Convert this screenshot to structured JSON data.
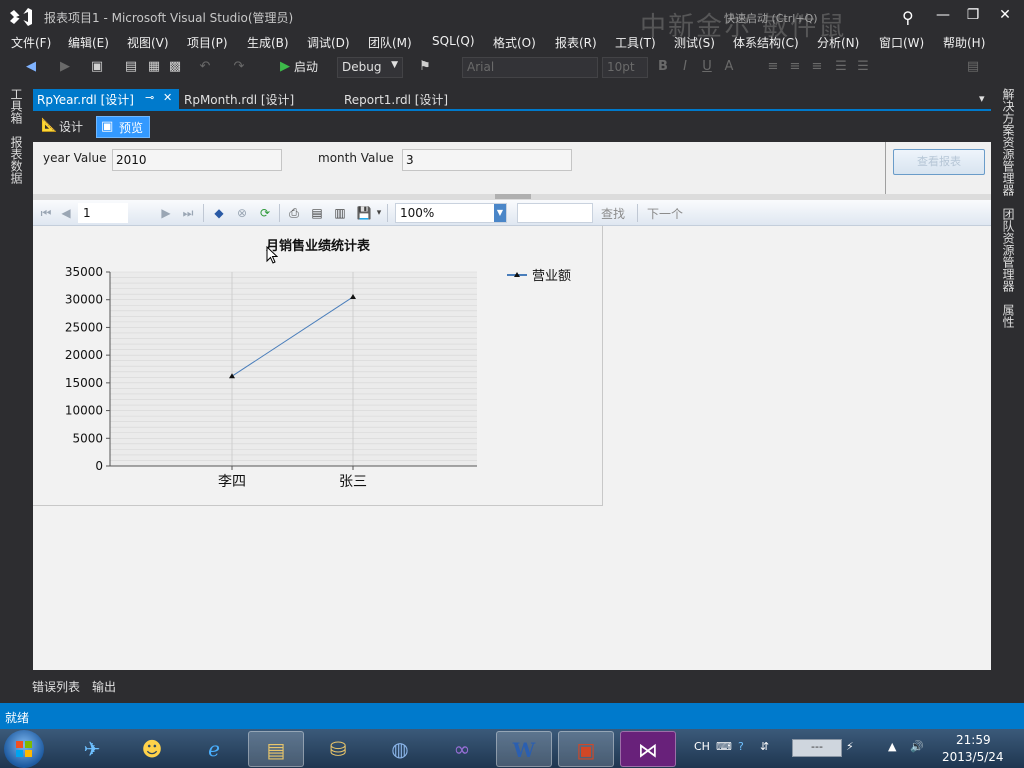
{
  "window": {
    "title": "报表项目1 - Microsoft Visual Studio(管理员)",
    "quick_launch": "快速启动 (Ctrl+Q)",
    "watermark": "中新金尔  敏件鼠",
    "minimize": "—",
    "restore": "❐",
    "close": "✕"
  },
  "menu": [
    "文件(F)",
    "编辑(E)",
    "视图(V)",
    "项目(P)",
    "生成(B)",
    "调试(D)",
    "团队(M)",
    "SQL(Q)",
    "格式(O)",
    "报表(R)",
    "工具(T)",
    "测试(S)",
    "体系结构(C)",
    "分析(N)",
    "窗口(W)",
    "帮助(H)"
  ],
  "toolbar": {
    "start_label": "启动",
    "config": "Debug",
    "font": "Arial",
    "font_size": "10pt",
    "bold": "B",
    "italic": "I",
    "underline": "U",
    "font_color": "A"
  },
  "left_rail": {
    "toolbox": "工具箱",
    "report_data": "报表数据"
  },
  "right_rail": {
    "solution_explorer": "解决方案资源管理器",
    "team_explorer": "团队资源管理器",
    "properties": "属性"
  },
  "doc_tabs": [
    {
      "label": "RpYear.rdl [设计]",
      "active": true,
      "pin": "⊸",
      "close": "✕"
    },
    {
      "label": "RpMonth.rdl [设计]",
      "active": false
    },
    {
      "label": "Report1.rdl [设计]",
      "active": false
    }
  ],
  "doc_tabs_dropdown": "▾",
  "view_switch": {
    "design": "设计",
    "preview": "预览"
  },
  "params": {
    "year_label": "year Value",
    "year_value": "2010",
    "month_label": "month Value",
    "month_value": "3",
    "view_report_button": "查看报表"
  },
  "report_toolbar": {
    "page": "1",
    "zoom": "100%",
    "find_label": "查找",
    "next_label": "下一个"
  },
  "chart_data": {
    "type": "line",
    "title": "月销售业绩统计表",
    "categories": [
      "李四",
      "张三"
    ],
    "series": [
      {
        "name": "营业额",
        "values": [
          16200,
          30500
        ],
        "color": "#4a7ebb"
      }
    ],
    "xlabel": "",
    "ylabel": "",
    "ylim": [
      0,
      35000
    ],
    "yticks": [
      "35000",
      "30000",
      "25000",
      "20000",
      "15000",
      "10000",
      "5000",
      "0"
    ],
    "grid": true,
    "legend": "right"
  },
  "bottom_tabs": {
    "error_list": "错误列表",
    "output": "输出"
  },
  "status": "就绪",
  "tray": {
    "ime": "CH",
    "clock_time": "21:59",
    "clock_date": "2013/5/24"
  }
}
